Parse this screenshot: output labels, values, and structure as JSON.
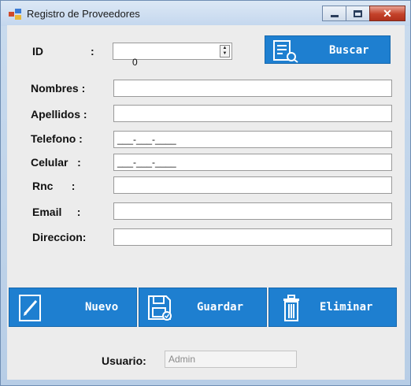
{
  "window": {
    "title": "Registro de Proveedores"
  },
  "form": {
    "id_label": "ID",
    "id_colon": ":",
    "id_value": "0",
    "buscar_label": "Buscar",
    "fields": [
      {
        "label": "Nombres :",
        "value": ""
      },
      {
        "label": "Apellidos :",
        "value": ""
      },
      {
        "label": "Telefono :",
        "value": "___-___-____"
      },
      {
        "label": "Celular   :",
        "value": "___-___-____"
      },
      {
        "label": "Rnc      :",
        "value": ""
      },
      {
        "label": "Email     :",
        "value": ""
      },
      {
        "label": "Direccion:",
        "value": ""
      }
    ]
  },
  "actions": {
    "nuevo_label": "Nuevo",
    "guardar_label": "Guardar",
    "eliminar_label": "Eliminar"
  },
  "footer": {
    "usuario_label": "Usuario:",
    "usuario_value": "Admin"
  },
  "colors": {
    "button_blue": "#1e7fd0",
    "window_frame": "#b7cde6",
    "client_bg": "#ececec"
  },
  "icons": [
    "app-form-icon",
    "search-document-icon",
    "edit-document-icon",
    "save-disk-icon",
    "trash-icon"
  ]
}
